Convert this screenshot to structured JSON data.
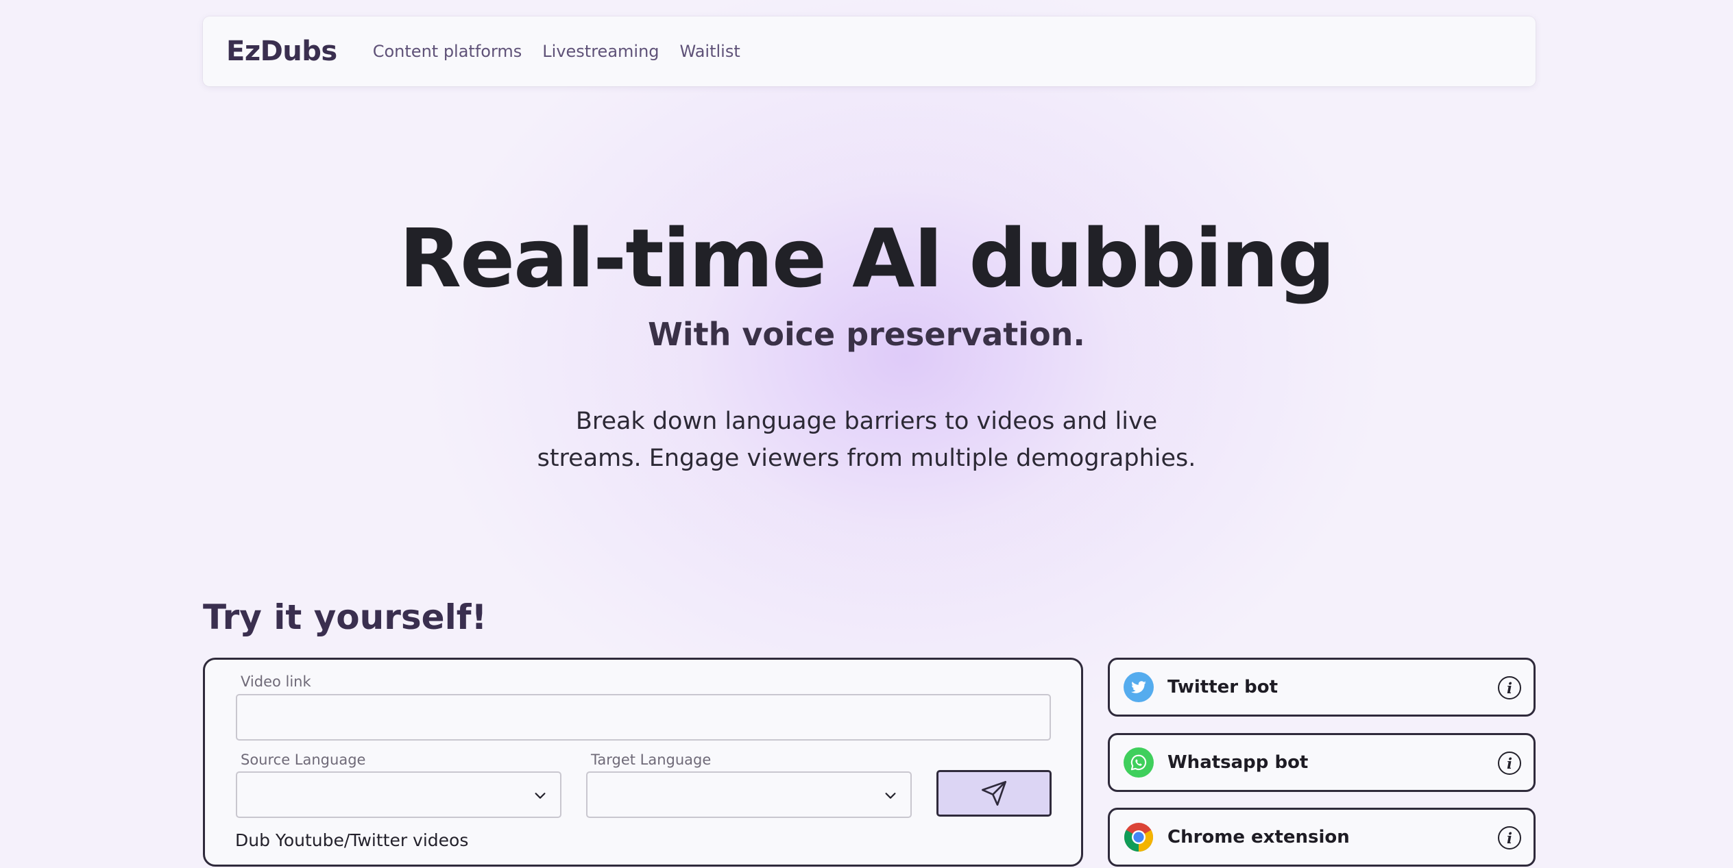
{
  "nav": {
    "logo": "EzDubs",
    "links": [
      "Content platforms",
      "Livestreaming",
      "Waitlist"
    ]
  },
  "hero": {
    "title": "Real-time AI dubbing",
    "subtitle": "With voice preservation.",
    "description": "Break down language barriers to videos and live streams. Engage viewers from multiple demographies."
  },
  "try_section": {
    "title": "Try it yourself!",
    "video_link_label": "Video link",
    "video_link_value": "",
    "source_language_label": "Source Language",
    "source_language_value": "",
    "target_language_label": "Target Language",
    "target_language_value": "",
    "caption": "Dub Youtube/Twitter videos"
  },
  "bots": [
    {
      "label": "Twitter bot",
      "icon": "twitter-icon",
      "color": "#55acee"
    },
    {
      "label": "Whatsapp bot",
      "icon": "whatsapp-icon",
      "color": "#3fcf5c"
    },
    {
      "label": "Chrome extension",
      "icon": "chrome-icon",
      "color": "#4285f4"
    }
  ],
  "colors": {
    "background": "#f5f1fb",
    "accent_glow": "#d7bef8",
    "send_button": "#dcd5f4",
    "border_dark": "#2f2a3b"
  }
}
